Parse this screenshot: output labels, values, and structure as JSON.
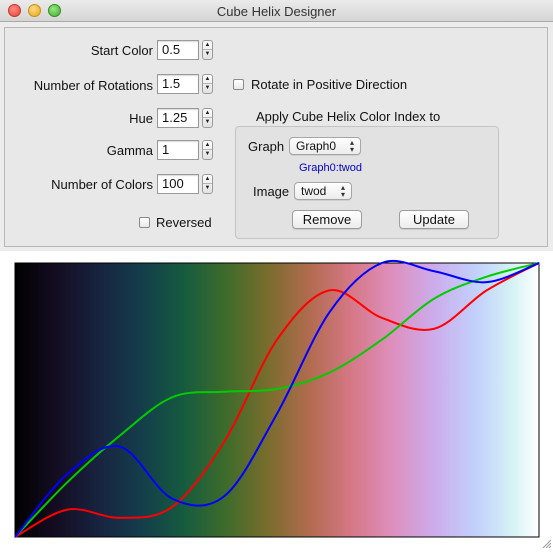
{
  "window": {
    "title": "Cube Helix Designer"
  },
  "params": {
    "start_color": {
      "label": "Start Color",
      "value": "0.5"
    },
    "rotations": {
      "label": "Number of Rotations",
      "value": "1.5"
    },
    "hue": {
      "label": "Hue",
      "value": "1.25"
    },
    "gamma": {
      "label": "Gamma",
      "value": "1"
    },
    "num_colors": {
      "label": "Number of Colors",
      "value": "100"
    },
    "reversed": {
      "label": "Reversed",
      "checked": false
    },
    "positive": {
      "label": "Rotate in Positive Direction",
      "checked": false
    }
  },
  "apply": {
    "heading": "Apply Cube Helix Color Index to",
    "graph_label": "Graph",
    "graph_value": "Graph0",
    "target_link": "Graph0:twod",
    "image_label": "Image",
    "image_value": "twod",
    "remove_label": "Remove",
    "update_label": "Update"
  },
  "icons": {
    "stepper": "stepper-arrows-icon",
    "popup": "popup-chevrons-icon",
    "grip": "resize-grip-icon"
  },
  "colors": {
    "red_curve": "#ff0000",
    "green_curve": "#00cc00",
    "blue_curve": "#0000ff"
  },
  "chart_data": {
    "type": "line",
    "title": "",
    "xlabel": "",
    "ylabel": "",
    "background": "cubehelix colormap gradient",
    "xlim": [
      0,
      1
    ],
    "ylim": [
      0,
      1
    ],
    "grid": false,
    "x": [
      0.0,
      0.1,
      0.2,
      0.3,
      0.4,
      0.5,
      0.6,
      0.7,
      0.8,
      0.9,
      1.0
    ],
    "series": [
      {
        "color": "red",
        "values": [
          0.0,
          0.1,
          0.07,
          0.11,
          0.35,
          0.72,
          0.9,
          0.8,
          0.76,
          0.9,
          1.0
        ]
      },
      {
        "color": "green",
        "values": [
          0.0,
          0.2,
          0.37,
          0.51,
          0.53,
          0.54,
          0.6,
          0.72,
          0.87,
          0.95,
          1.0
        ]
      },
      {
        "color": "blue",
        "values": [
          0.0,
          0.23,
          0.33,
          0.14,
          0.15,
          0.45,
          0.82,
          1.0,
          0.97,
          0.93,
          1.0
        ]
      }
    ]
  }
}
